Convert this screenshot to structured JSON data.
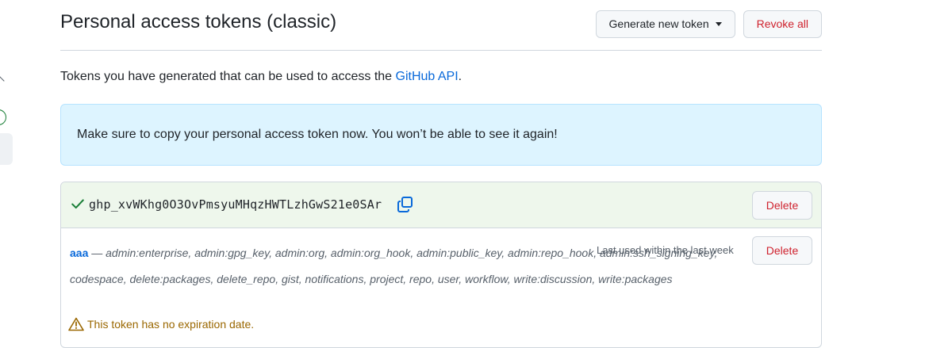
{
  "header": {
    "title": "Personal access tokens (classic)",
    "generate_label": "Generate new token",
    "revoke_label": "Revoke all"
  },
  "intro": {
    "text": "Tokens you have generated that can be used to access the ",
    "link": "GitHub API",
    "suffix": "."
  },
  "flash": {
    "message": "Make sure to copy your personal access token now. You won’t be able to see it again!"
  },
  "new_token": {
    "value": "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",
    "delete_label": "Delete"
  },
  "token": {
    "name": "aaa",
    "separator": " — ",
    "scopes": "admin:enterprise, admin:gpg_key, admin:org, admin:org_hook, admin:public_key, admin:repo_hook, admin:ssh_signing_key, codespace, delete:packages, delete_repo, gist, notifications, project, repo, user, workflow, write:discussion, write:packages",
    "last_used": "Last used within the last week",
    "delete_label": "Delete",
    "warning": "This token has no expiration date."
  },
  "colors": {
    "link": "#0969da",
    "danger": "#cf222e",
    "success": "#1a7f37",
    "flash_bg": "#ddf4ff",
    "new_token_bg": "#eef7ec",
    "warning": "#9a6700"
  }
}
